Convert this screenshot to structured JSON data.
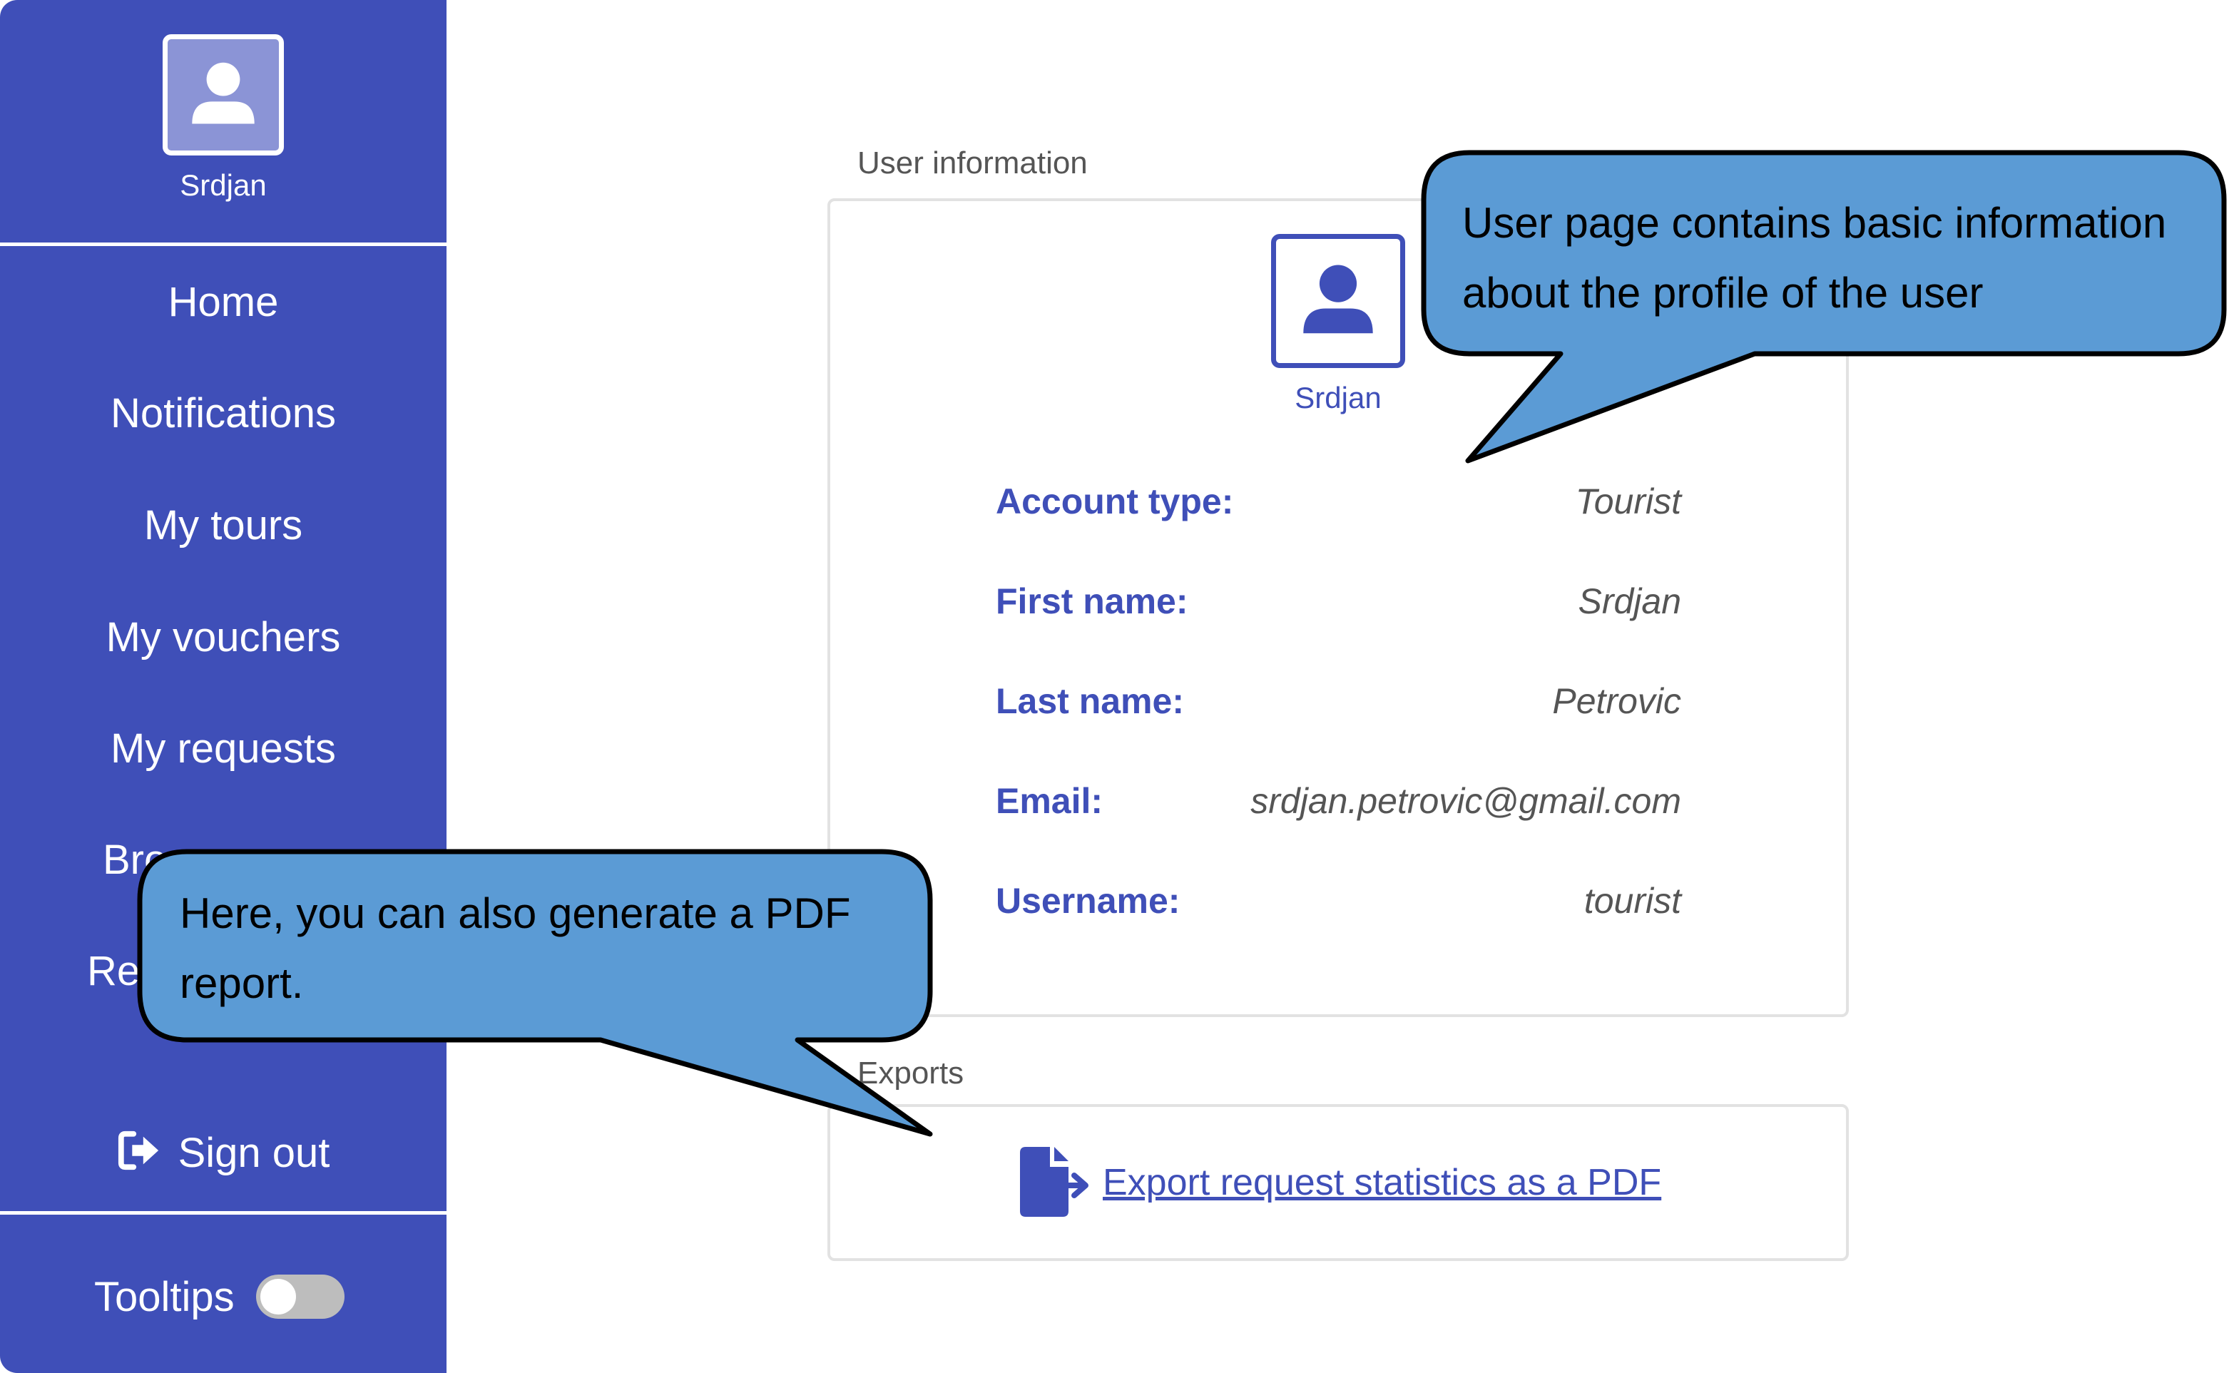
{
  "sidebar": {
    "username": "Srdjan",
    "nav_items": [
      "Home",
      "Notifications",
      "My tours",
      "My vouchers",
      "My requests",
      "Bro",
      "Re"
    ],
    "sign_out": "Sign out",
    "tooltips_label": "Tooltips",
    "tooltips_enabled": false,
    "background_color": "#3f4fb8"
  },
  "user_info": {
    "section_title": "User information",
    "username_display": "Srdjan",
    "fields": [
      {
        "label": "Account type:",
        "value": "Tourist"
      },
      {
        "label": "First name:",
        "value": "Srdjan"
      },
      {
        "label": "Last name:",
        "value": "Petrovic"
      },
      {
        "label": "Email:",
        "value": "srdjan.petrovic@gmail.com"
      },
      {
        "label": "Username:",
        "value": "tourist"
      }
    ]
  },
  "exports": {
    "section_title": "Exports",
    "link_text": "Export request statistics as a PDF",
    "icon": "file-export-icon"
  },
  "callouts": {
    "top": "User page contains basic information about the profile of the user",
    "top_lines": [
      "User page contains basic information",
      "about the profile of the user"
    ],
    "bottom": "Here, you can also generate a PDF report.",
    "bottom_lines": [
      "Here, you can also generate a PDF",
      "report."
    ],
    "fill_color": "#5b9bd5"
  },
  "icons": {
    "avatar": "user-icon",
    "sign_out": "sign-out-icon"
  }
}
